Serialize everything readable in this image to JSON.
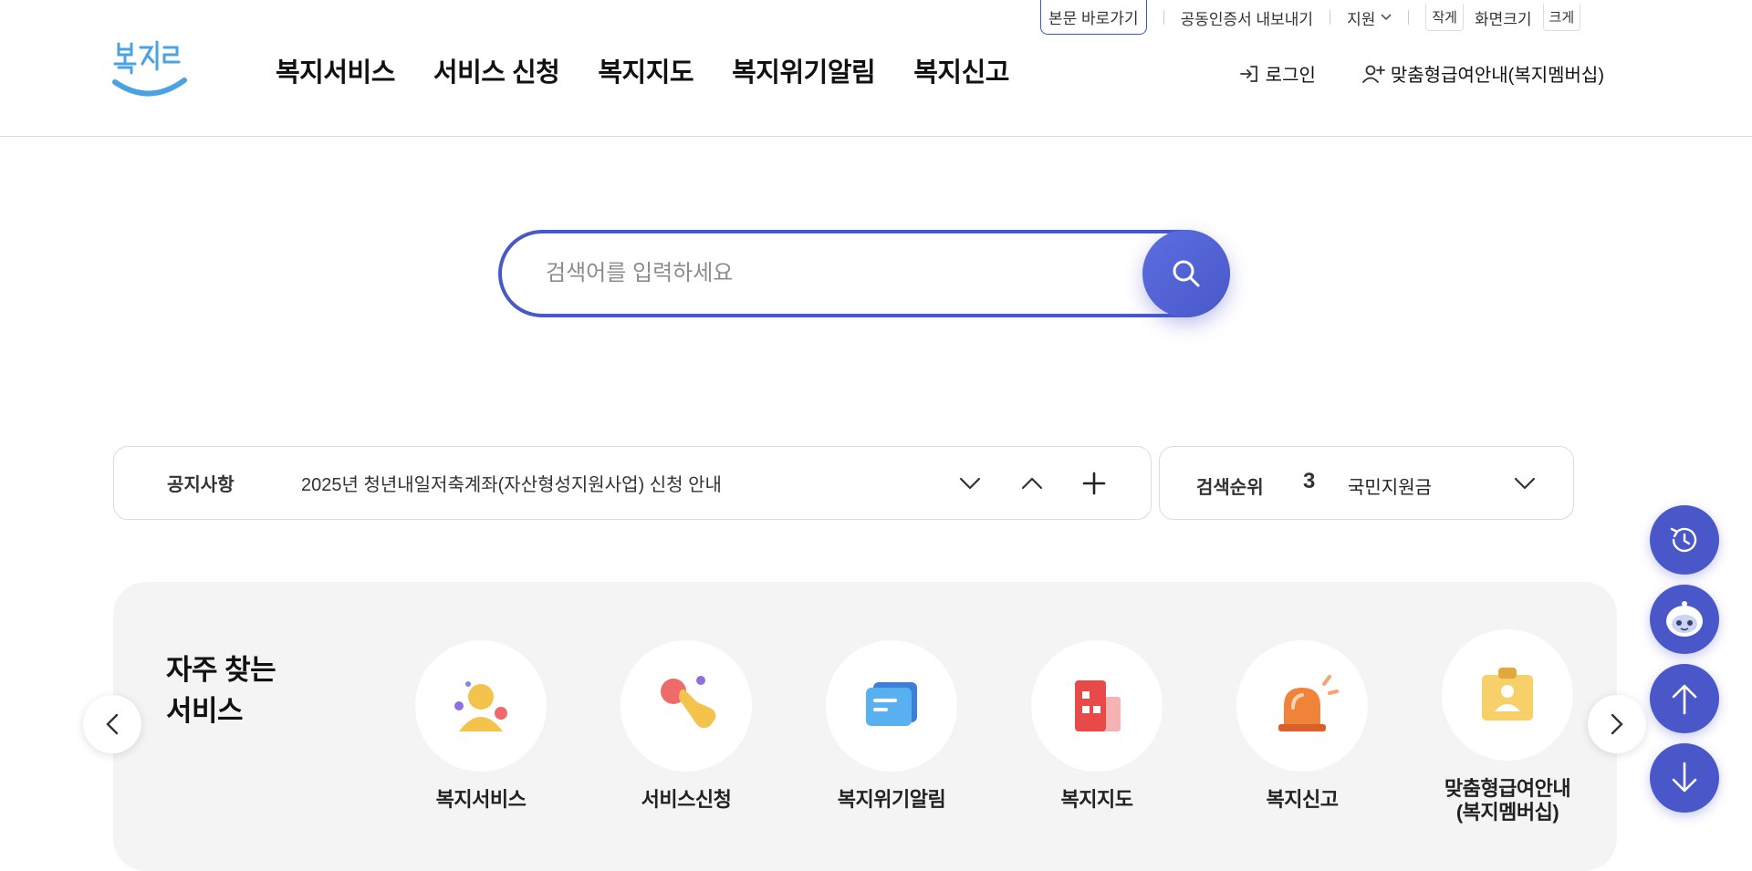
{
  "utility": {
    "skip_link": "본문 바로가기",
    "cert_export": "공동인증서 내보내기",
    "support": "지원",
    "size_small": "작게",
    "size_label": "화면크기",
    "size_large": "크게"
  },
  "logo": {
    "text": "복지로"
  },
  "nav": {
    "items": [
      "복지서비스",
      "서비스 신청",
      "복지지도",
      "복지위기알림",
      "복지신고"
    ]
  },
  "header_right": {
    "login": "로그인",
    "membership": "맞춤형급여안내(복지멤버십)"
  },
  "search": {
    "placeholder": "검색어를 입력하세요",
    "value": ""
  },
  "notice": {
    "label": "공지사항",
    "text": "2025년 청년내일저축계좌(자산형성지원사업) 신청 안내"
  },
  "ranking": {
    "label": "검색순위",
    "number": "3",
    "keyword": "국민지원금"
  },
  "frequent": {
    "title_line1": "자주 찾는",
    "title_line2": "서비스",
    "items": [
      {
        "label": "복지서비스",
        "icon": "person-icon"
      },
      {
        "label": "서비스신청",
        "icon": "hand-tap-icon"
      },
      {
        "label": "복지위기알림",
        "icon": "message-icon"
      },
      {
        "label": "복지지도",
        "icon": "building-icon"
      },
      {
        "label": "복지신고",
        "icon": "siren-icon"
      },
      {
        "label_line1": "맞춤형급여안내",
        "label_line2": "(복지멤버십)",
        "icon": "id-card-icon"
      }
    ]
  },
  "colors": {
    "accent": "#4a57c9",
    "search_border": "#4759c9",
    "panel_bg": "#f4f4f4"
  }
}
